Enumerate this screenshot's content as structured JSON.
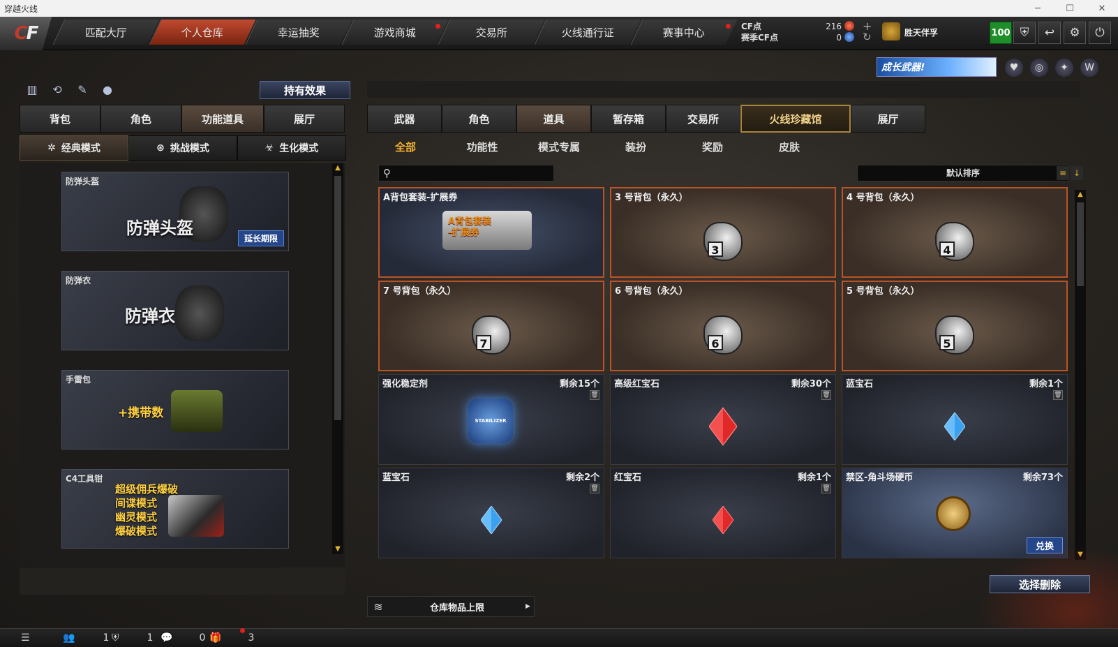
{
  "window": {
    "title": "穿越火线"
  },
  "nav": {
    "logo": "CF",
    "tabs": [
      "匹配大厅",
      "个人仓库",
      "幸运抽奖",
      "游戏商城",
      "交易所",
      "火线通行证",
      "赛事中心"
    ],
    "active_index": 1
  },
  "currency": {
    "cf_label": "CF点",
    "season_label": "赛季CF点",
    "cf_value": "216",
    "season_value": "0"
  },
  "user": {
    "name": "胜天伴孚",
    "level": "100"
  },
  "banner": {
    "text": "成长武器!"
  },
  "left": {
    "effect_button": "持有效果",
    "tabs": [
      "背包",
      "角色",
      "功能道具",
      "展厅"
    ],
    "active_tab": 2,
    "modes": [
      "经典模式",
      "挑战模式",
      "生化模式"
    ],
    "items": [
      {
        "name": "防弹头盔",
        "big": "防弹头盔",
        "badge": "延长期限"
      },
      {
        "name": "防弹衣",
        "big": "防弹衣"
      },
      {
        "name": "手雷包",
        "big": "+携带数"
      },
      {
        "name": "C4工具钳",
        "lines": [
          "超级佣兵爆破",
          "间谍模式",
          "幽灵模式",
          "爆破模式"
        ]
      }
    ]
  },
  "right": {
    "tabs": [
      "武器",
      "角色",
      "道具",
      "暂存箱",
      "交易所",
      "火线珍藏馆",
      "展厅"
    ],
    "active_tab": 2,
    "highlight_tab": 5,
    "subtabs": [
      "全部",
      "功能性",
      "模式专属",
      "装扮",
      "奖励",
      "皮肤"
    ],
    "active_subtab": 0,
    "search_placeholder": "",
    "sort_label": "默认排序",
    "items": [
      {
        "name": "A背包套装-扩展券",
        "type": "coupon",
        "art": "A背包套装\n-扩展券"
      },
      {
        "name": "3 号背包（永久）",
        "type": "bag",
        "num": "3"
      },
      {
        "name": "4 号背包（永久）",
        "type": "bag",
        "num": "4"
      },
      {
        "name": "7 号背包（永久）",
        "type": "bag",
        "num": "7"
      },
      {
        "name": "6 号背包（永久）",
        "type": "bag",
        "num": "6"
      },
      {
        "name": "5 号背包（永久）",
        "type": "bag",
        "num": "5"
      },
      {
        "name": "强化稳定剂",
        "type": "stabilizer",
        "count": "剩余15个",
        "art": "STABILIZER"
      },
      {
        "name": "高级红宝石",
        "type": "ruby-big",
        "count": "剩余30个"
      },
      {
        "name": "蓝宝石",
        "type": "sapphire",
        "count": "剩余1个"
      },
      {
        "name": "蓝宝石",
        "type": "sapphire",
        "count": "剩余2个"
      },
      {
        "name": "红宝石",
        "type": "ruby",
        "count": "剩余1个"
      },
      {
        "name": "禁区-角斗场硬币",
        "type": "coin",
        "count": "剩余73个",
        "action": "兑换"
      }
    ],
    "capacity_label": "仓库物品上限",
    "delete_button": "选择删除"
  },
  "statusbar": {
    "friends": "1",
    "clan": "1",
    "messages": "0",
    "gifts": "3"
  },
  "colors": {
    "accent_gold": "#f0b030",
    "nav_active": "#c04a30",
    "bag_border": "#b85428",
    "level_green": "#1e8e2a"
  }
}
